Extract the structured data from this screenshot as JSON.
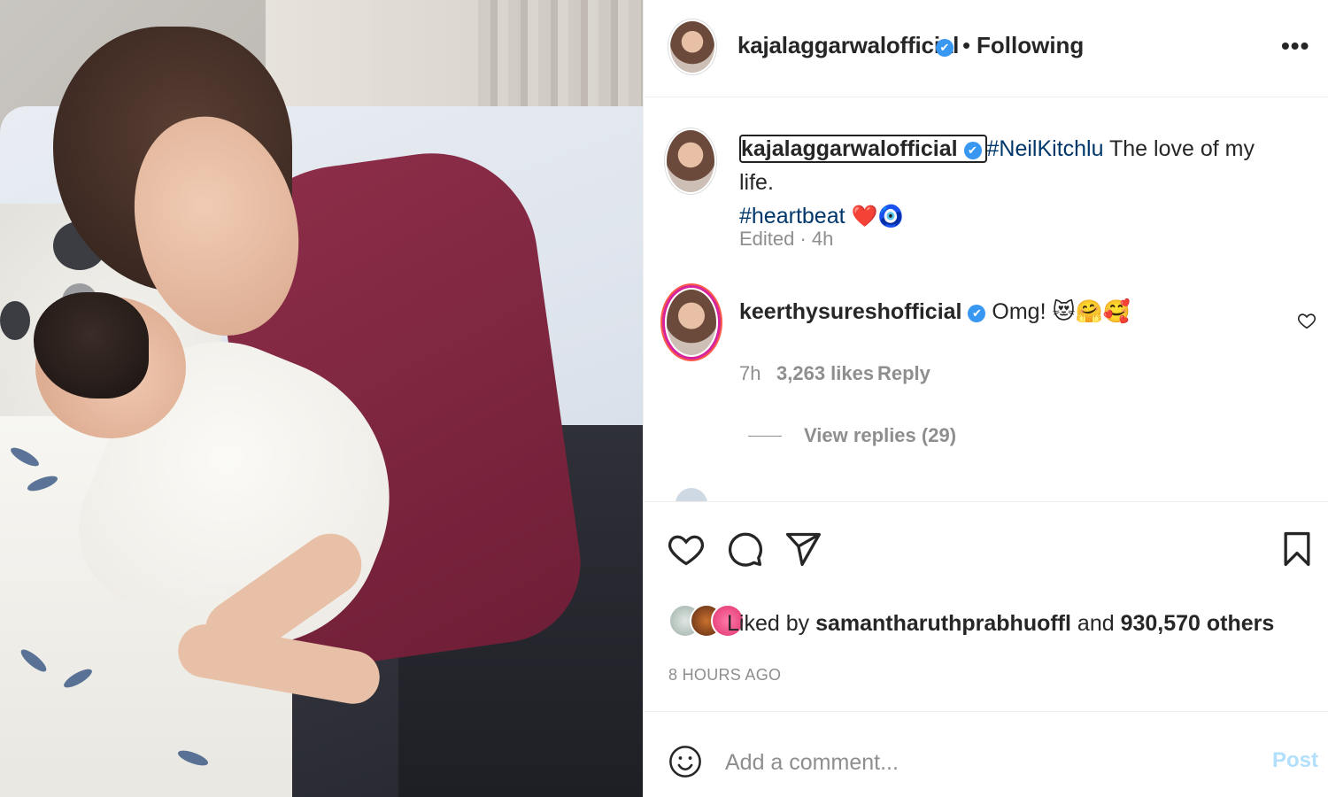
{
  "header": {
    "username": "kajalaggarwalofficial",
    "verified_mark": "✔",
    "separator": "•",
    "follow_status": "Following",
    "more_label": "•••"
  },
  "caption": {
    "username": "kajalaggarwalofficial",
    "hashtag1": "#NeilKitchlu",
    "text": " The love of my life.",
    "hashtag2": "#heartbeat",
    "emojis": "❤️🧿",
    "meta": "Edited · 4h"
  },
  "reply": {
    "username": "keerthysureshofficial",
    "text": "Omg! 😻🤗🥰",
    "time": "7h",
    "likes": "3,263 likes",
    "reply_label": "Reply",
    "view_replies": "View replies (29)"
  },
  "likes": {
    "prefix": "Liked by ",
    "user": "samantharuthprabhuoffl",
    "middle": " and ",
    "count": "930,570 others"
  },
  "time_ago": "8 HOURS AGO",
  "comment": {
    "placeholder": "Add a comment...",
    "post_label": "Post"
  },
  "icons": {
    "like": "heart-icon",
    "comment": "comment-icon",
    "share": "paper-plane-icon",
    "save": "bookmark-icon",
    "emoji": "smiley-icon",
    "more": "ellipsis-icon"
  },
  "colors": {
    "verified": "#3897f0",
    "hashtag": "#00376b",
    "muted": "#8e8e8e",
    "post_disabled": "#b2dffc"
  }
}
